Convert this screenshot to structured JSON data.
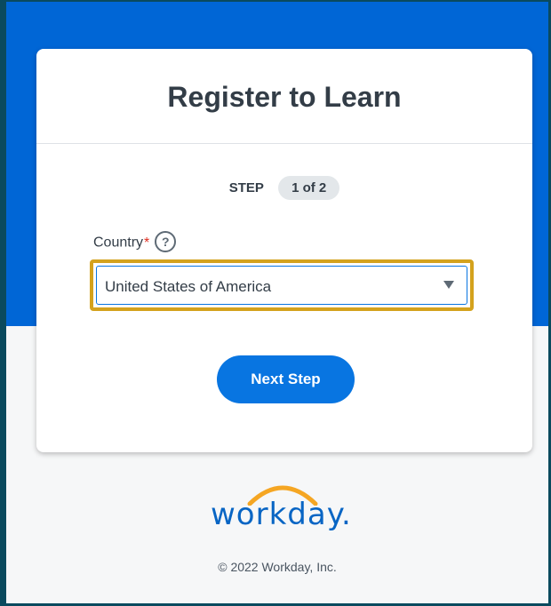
{
  "card": {
    "title": "Register to Learn",
    "step_label": "STEP",
    "step_progress": "1 of 2"
  },
  "form": {
    "country_label": "Country",
    "required_marker": "*",
    "help_icon_glyph": "?",
    "country_value": "United States of America",
    "next_button_label": "Next Step"
  },
  "footer": {
    "logo_text": "workday.",
    "copyright": "© 2022 Workday, Inc."
  },
  "colors": {
    "brand_blue": "#0066d6",
    "button_blue": "#0875e1",
    "focus_ring": "#d4a21d",
    "logo_arc_orange": "#f5a623",
    "required_red": "#de2e21"
  },
  "icons": {
    "help": "question-circle-icon",
    "dropdown": "caret-down-icon"
  }
}
